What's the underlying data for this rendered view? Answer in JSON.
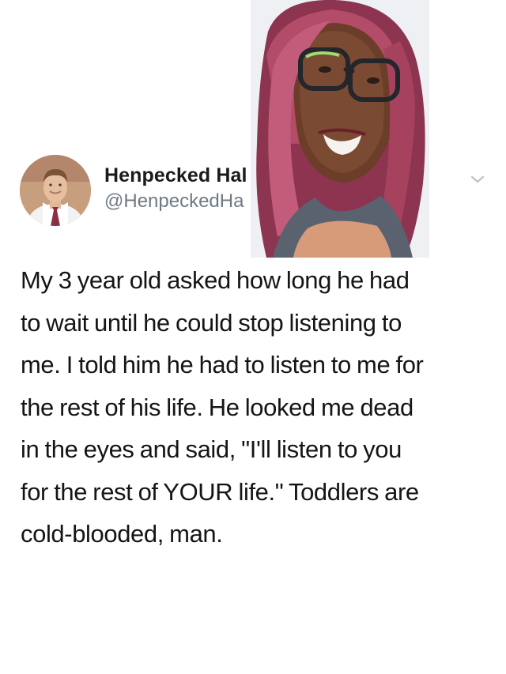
{
  "author": {
    "display_name": "Henpecked Hal",
    "handle": "@HenpeckedHa"
  },
  "tweet": {
    "lines": [
      "My 3 year old asked how long he had",
      "to wait until he could stop listening to",
      "me. I told him he had to listen to me for",
      "the rest of his life. He looked me dead",
      "in the eyes and said, \"I'll listen to you",
      "for the rest of YOUR life.\" Toddlers are",
      "cold-blooded, man."
    ]
  },
  "icons": {
    "menu": "chevron-down-icon"
  },
  "colors": {
    "text": "#151515",
    "handle": "#6e7a84",
    "chevron": "#b9c3cc"
  }
}
